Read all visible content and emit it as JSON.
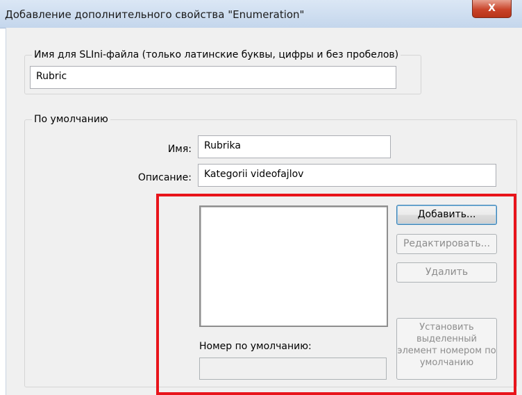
{
  "window": {
    "title": "Добавление дополнительного свойства \"Enumeration\"",
    "close_glyph": "X"
  },
  "ini_group": {
    "legend": "Имя для SLIni-файла (только латинские буквы, цифры и без пробелов)",
    "value": "Rubric"
  },
  "default_group": {
    "legend": "По умолчанию",
    "name_label": "Имя:",
    "name_value": "Rubrika",
    "desc_label": "Описание:",
    "desc_value": "Kategorii videofajlov"
  },
  "enum_panel": {
    "items": [],
    "default_number_label": "Номер по умолчанию:",
    "default_number_value": "",
    "buttons": {
      "add": "Добавить...",
      "edit": "Редактировать...",
      "delete": "Удалить",
      "set_default": "Установить выделенный элемент номером по умолчанию"
    }
  },
  "highlight_color": "#e8141b"
}
